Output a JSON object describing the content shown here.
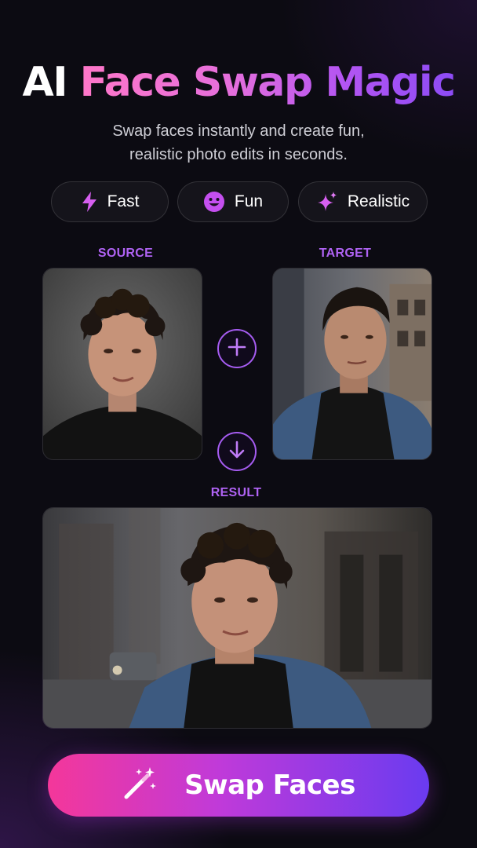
{
  "header": {
    "title_plain": "AI",
    "title_gradient": "Face Swap Magic",
    "subtitle_line1": "Swap faces instantly and create fun,",
    "subtitle_line2": "realistic photo edits in seconds."
  },
  "features": [
    {
      "label": "Fast",
      "icon": "lightning-icon"
    },
    {
      "label": "Fun",
      "icon": "smiley-icon"
    },
    {
      "label": "Realistic",
      "icon": "sparkle-icon"
    }
  ],
  "labels": {
    "source": "SOURCE",
    "target": "TARGET",
    "result": "RESULT"
  },
  "icons": {
    "combine": "plus-icon",
    "arrow": "arrow-down-icon",
    "cta": "magic-wand-icon"
  },
  "cta": {
    "label": "Swap Faces"
  },
  "colors": {
    "accent_purple": "#a55cf0",
    "gradient_start": "#f4379a",
    "gradient_end": "#6a3bf0",
    "background": "#0c0b12"
  }
}
